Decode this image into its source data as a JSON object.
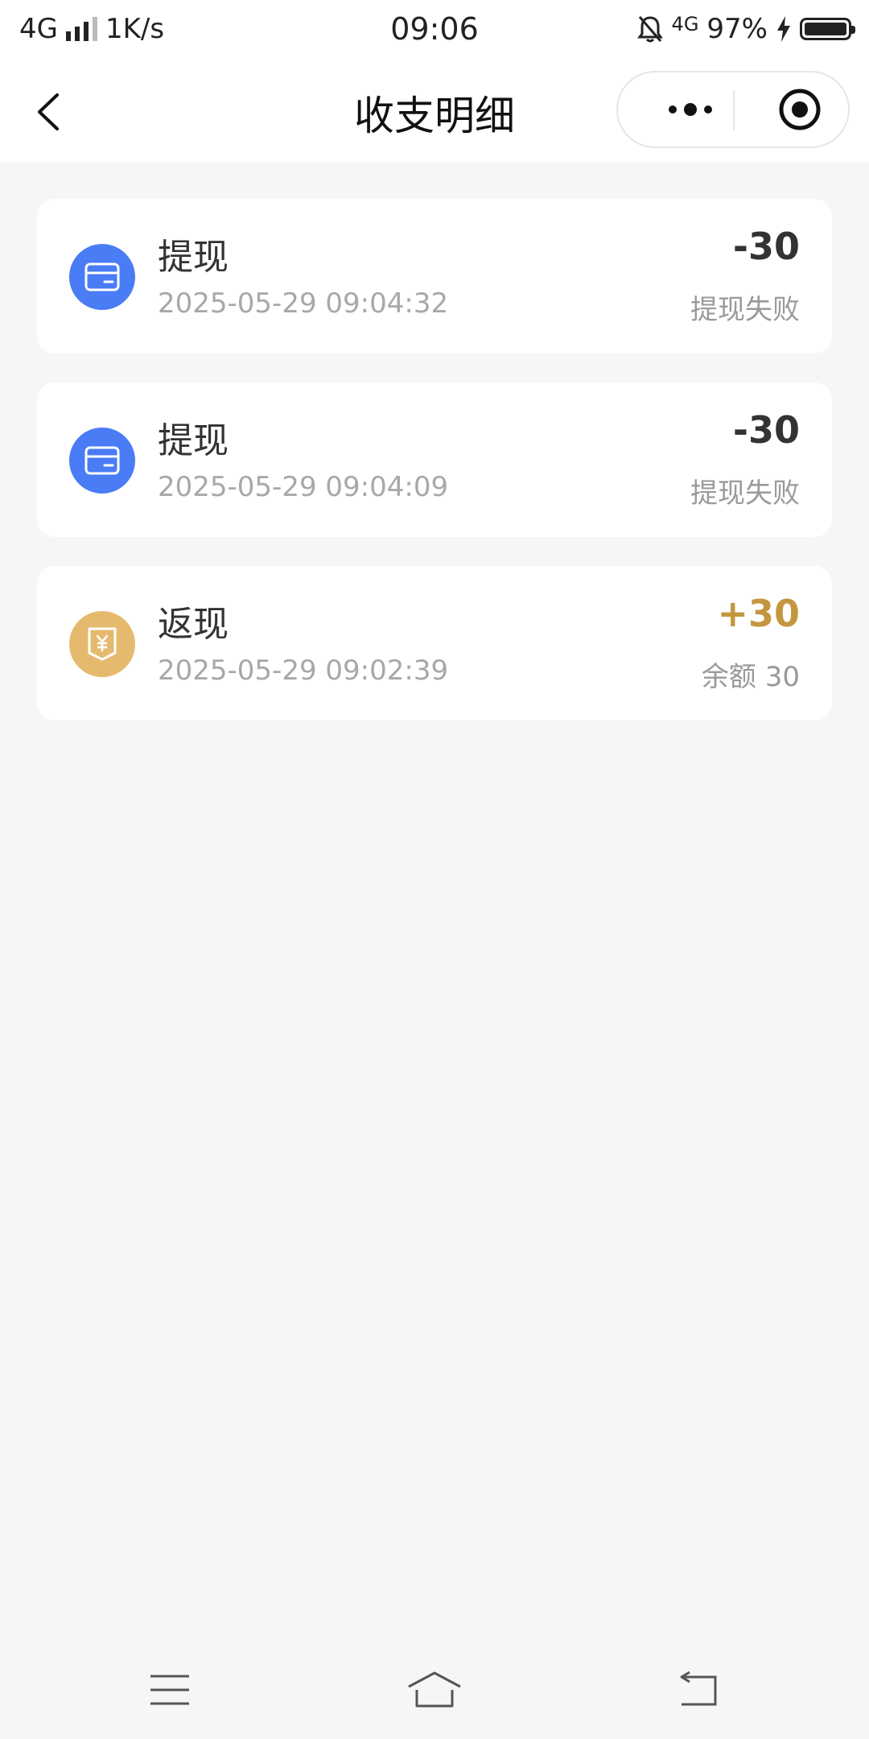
{
  "status_bar": {
    "network": "4G",
    "speed": "1K/s",
    "time": "09:06",
    "network_right": "4G",
    "battery": "97%"
  },
  "nav": {
    "title": "收支明细",
    "back_icon": "chevron-left-icon",
    "more_icon": "more-dots-icon",
    "close_icon": "target-close-icon"
  },
  "records": [
    {
      "title": "提现",
      "time": "2025-05-29 09:04:32",
      "amount": "-30",
      "status": "提现失败",
      "icon": "card-icon",
      "icon_color": "#4a7cf6",
      "amount_color": "#333333"
    },
    {
      "title": "提现",
      "time": "2025-05-29 09:04:09",
      "amount": "-30",
      "status": "提现失败",
      "icon": "card-icon",
      "icon_color": "#4a7cf6",
      "amount_color": "#333333"
    },
    {
      "title": "返现",
      "time": "2025-05-29 09:02:39",
      "amount": "+30",
      "status": "余额 30",
      "icon": "yuan-badge-icon",
      "icon_color": "#e6ba6e",
      "amount_color": "#c4973f"
    }
  ],
  "bottom_nav": {
    "menu_icon": "menu-icon",
    "home_icon": "home-icon",
    "back_icon": "return-icon"
  }
}
